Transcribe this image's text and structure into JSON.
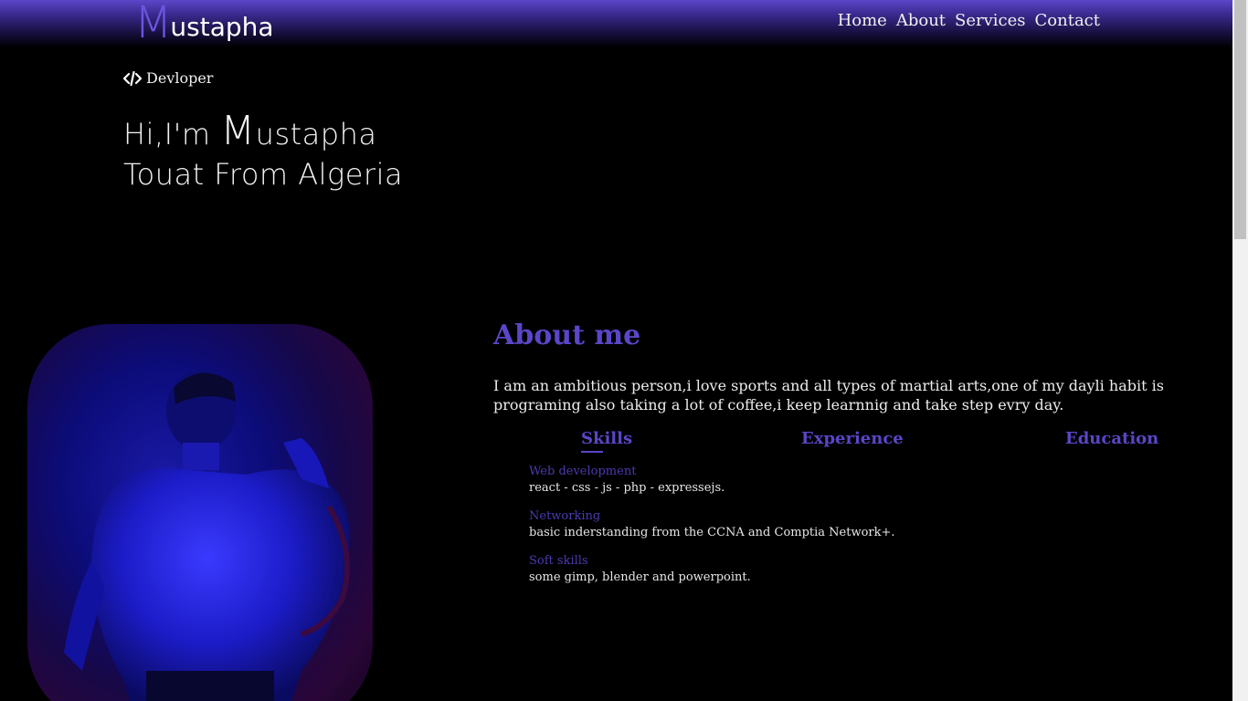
{
  "logo": {
    "initial": "M",
    "rest": "ustapha"
  },
  "nav": {
    "items": [
      "Home",
      "About",
      "Services",
      "Contact"
    ]
  },
  "role": {
    "label": "Devloper",
    "icon": "code-icon"
  },
  "hero": {
    "line1_prefix": "Hi,I'm ",
    "line1_initial": "M",
    "line1_rest": "ustapha",
    "line2": "Touat From Algeria"
  },
  "photo": {
    "alt": "profile-photo"
  },
  "about": {
    "title": "About me",
    "text": "I am an ambitious person,i love sports and all types of martial arts,one of my dayli habit is programing also taking a lot of coffee,i keep learnnig and take step evry day."
  },
  "tabs": [
    {
      "label": "Skills",
      "active": true
    },
    {
      "label": "Experience",
      "active": false
    },
    {
      "label": "Education",
      "active": false
    }
  ],
  "skills": [
    {
      "title": "Web development",
      "desc": "react - css - js - php - expressejs."
    },
    {
      "title": "Networking",
      "desc": "basic inderstanding from the CCNA and Comptia Network+."
    },
    {
      "title": "Soft skills",
      "desc": "some gimp, blender and powerpoint."
    }
  ],
  "colors": {
    "accent": "#5a46c8",
    "background": "#000000",
    "text": "#ffffff"
  }
}
